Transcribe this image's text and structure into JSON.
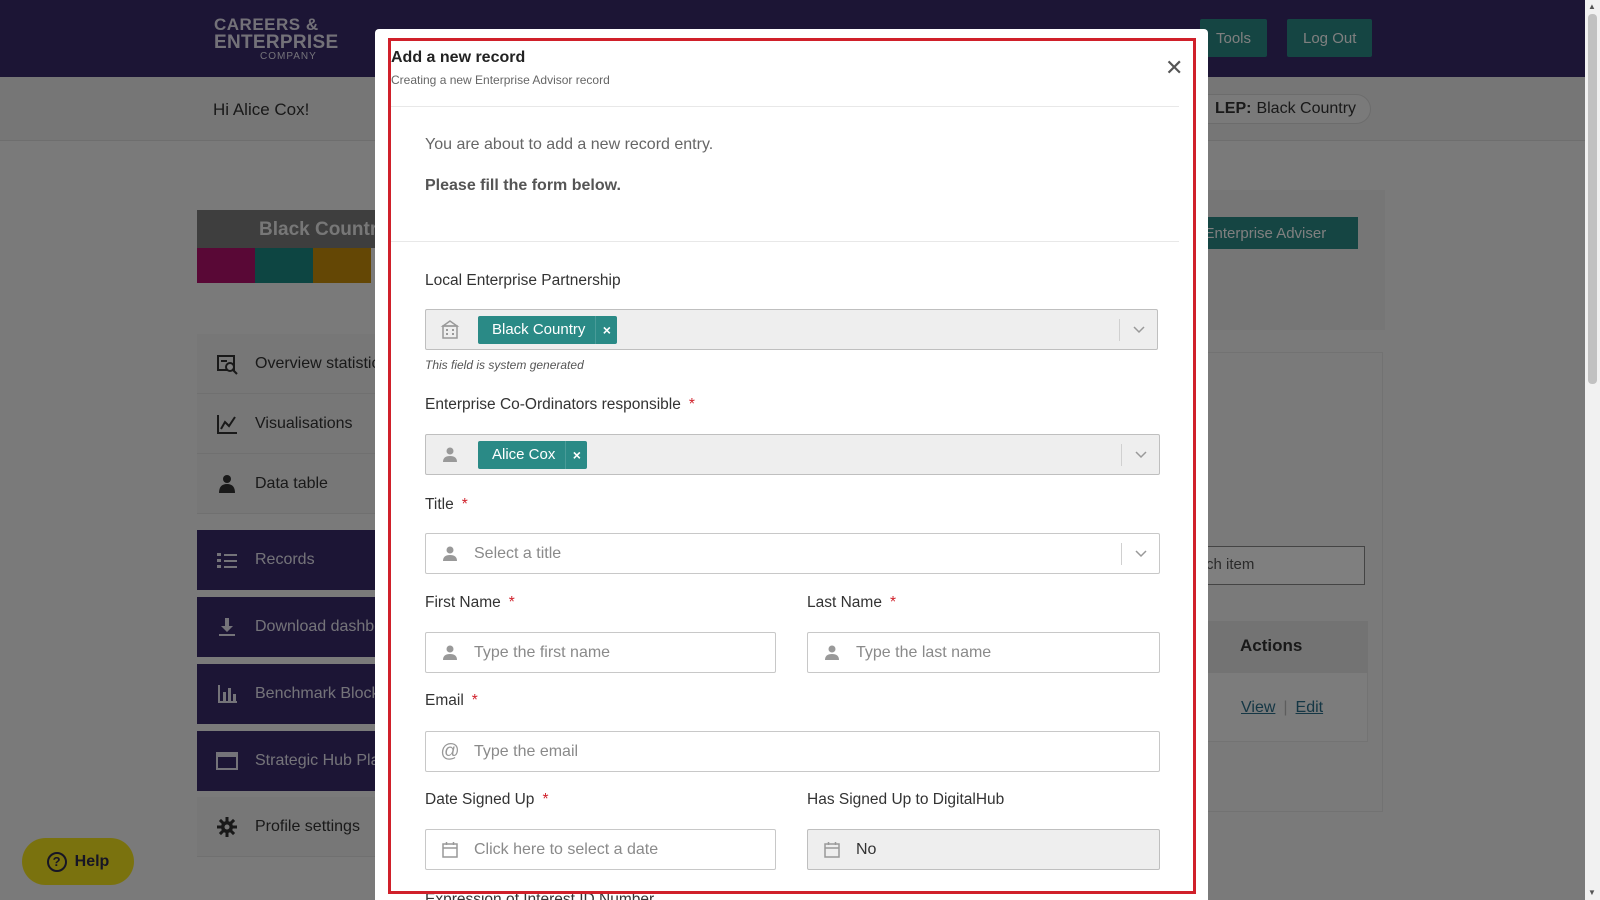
{
  "header": {
    "logo_line1": "CAREERS &",
    "logo_line2": "ENTERPRISE",
    "logo_line3": "COMPANY",
    "tools_label": "Tools",
    "logout_label": "Log Out"
  },
  "subheader": {
    "greeting": "Hi Alice Cox!",
    "lep_label": "LEP:",
    "lep_value": "Black Country"
  },
  "brand": {
    "title": "Black Country",
    "stripe_colors": [
      "#b3106c",
      "#1a8a84",
      "#c98f0a"
    ]
  },
  "sidebar": {
    "items": [
      {
        "label": "Overview statistics",
        "icon": "magnifier-chart-icon"
      },
      {
        "label": "Visualisations",
        "icon": "chart-icon"
      },
      {
        "label": "Data table",
        "icon": "people-icon"
      },
      {
        "label": "Records",
        "icon": "checklist-icon"
      },
      {
        "label": "Download dashboard",
        "icon": "download-icon"
      },
      {
        "label": "Benchmark Block",
        "icon": "bar-chart-icon"
      },
      {
        "label": "Strategic Hub Plan",
        "icon": "window-icon"
      },
      {
        "label": "Profile settings",
        "icon": "gear-icon"
      }
    ]
  },
  "background_right": {
    "add_button": "n Enterprise Adviser",
    "search_placeholder": "rch item",
    "actions_header": "Actions",
    "view_link": "View",
    "edit_link": "Edit"
  },
  "help": {
    "label": "Help"
  },
  "modal": {
    "title": "Add a new record",
    "subtitle": "Creating a new Enterprise Advisor record",
    "intro": "You are about to add a new record entry.",
    "instruction": "Please fill the form below.",
    "lep": {
      "label": "Local Enterprise Partnership",
      "tag": "Black Country",
      "hint": "This field is system generated"
    },
    "coordinators": {
      "label": "Enterprise Co-Ordinators responsible",
      "tag": "Alice Cox"
    },
    "title_field": {
      "label": "Title",
      "placeholder": "Select a title"
    },
    "first_name": {
      "label": "First Name",
      "placeholder": "Type the first name"
    },
    "last_name": {
      "label": "Last Name",
      "placeholder": "Type the last name"
    },
    "email": {
      "label": "Email",
      "placeholder": "Type the email"
    },
    "date_signed": {
      "label": "Date Signed Up",
      "placeholder": "Click here to select a date"
    },
    "digitalhub": {
      "label": "Has Signed Up to DigitalHub",
      "value": "No"
    },
    "next_label": "Expression of Interest ID Number",
    "required_mark": "*"
  },
  "colors": {
    "header": "#382a6b",
    "accent": "#2a8a86",
    "highlight": "#d0202a",
    "help": "#f5e51d"
  }
}
